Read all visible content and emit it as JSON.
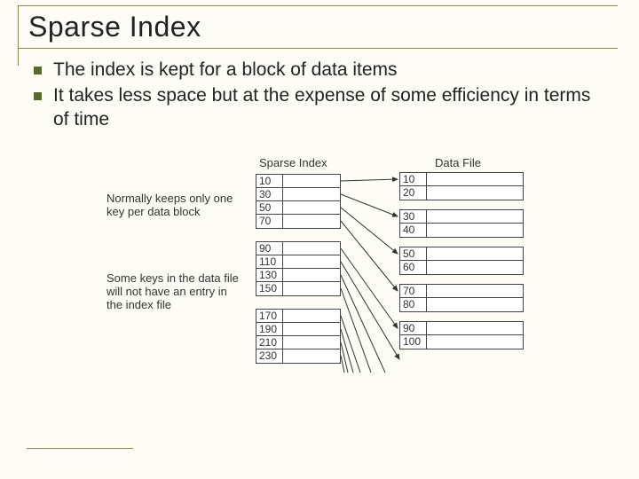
{
  "title": "Sparse Index",
  "bullets": [
    "The index is kept for a block of data items",
    "It takes less space but at the expense of some efficiency in terms of time"
  ],
  "diagram": {
    "labels": {
      "idx": "Sparse Index",
      "data": "Data File"
    },
    "notes": [
      "Normally keeps only one key per data block",
      "Some keys in the data file will not have an entry in the index file"
    ],
    "index_blocks": [
      {
        "keys": [
          "10",
          "30",
          "50",
          "70"
        ]
      },
      {
        "keys": [
          "90",
          "110",
          "130",
          "150"
        ]
      },
      {
        "keys": [
          "170",
          "190",
          "210",
          "230"
        ]
      }
    ],
    "data_blocks": [
      {
        "keys": [
          "10",
          "20"
        ]
      },
      {
        "keys": [
          "30",
          "40"
        ]
      },
      {
        "keys": [
          "50",
          "60"
        ]
      },
      {
        "keys": [
          "70",
          "80"
        ]
      },
      {
        "keys": [
          "90",
          "100"
        ]
      }
    ]
  }
}
